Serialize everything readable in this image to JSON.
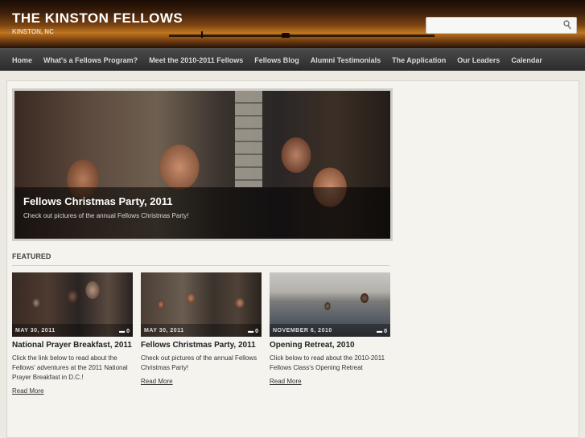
{
  "site": {
    "title": "THE KINSTON FELLOWS",
    "subtitle": "KINSTON, NC",
    "search_placeholder": ""
  },
  "nav": [
    "Home",
    "What's a Fellows Program?",
    "Meet the 2010-2011 Fellows",
    "Fellows Blog",
    "Alumni Testimonials",
    "The Application",
    "Our Leaders",
    "Calendar"
  ],
  "slider": {
    "title": "Fellows Christmas Party, 2011",
    "text": "Check out pictures of the annual Fellows Christmas Party!"
  },
  "featured": {
    "label": "FEATURED",
    "cards": [
      {
        "date": "MAY 30, 2011",
        "comments": "0",
        "title": "National Prayer Breakfast, 2011",
        "excerpt": "Click the link below to read about the Fellows' adventures at the 2011 National Prayer Breakfast in D.C.!",
        "link": "Read More"
      },
      {
        "date": "MAY 30, 2011",
        "comments": "0",
        "title": "Fellows Christmas Party, 2011",
        "excerpt": "Check out pictures of the annual Fellows Christmas Party!",
        "link": "Read More"
      },
      {
        "date": "NOVEMBER 6, 2010",
        "comments": "0",
        "title": "Opening Retreat, 2010",
        "excerpt": "Click below to read about the 2010-2011 Fellows Class's Opening Retreat",
        "link": "Read More"
      }
    ]
  },
  "colors": {
    "header_accent": "#c0761f",
    "nav_bg": "#2b2b2b",
    "content_bg": "#f4f3ee"
  }
}
